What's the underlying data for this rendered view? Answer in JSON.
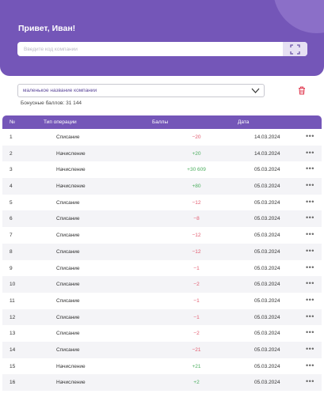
{
  "header": {
    "greeting": "Привет, Иван!",
    "search_placeholder": "Введите код компании",
    "scan_icon": "scan-icon"
  },
  "company": {
    "selected": "маленькое название компании",
    "bonus_text": "Бонусные баллов: 31 144"
  },
  "table": {
    "columns": [
      "№",
      "Тип операции",
      "Баллы",
      "Дата"
    ],
    "rows": [
      {
        "num": "1",
        "type": "Списание",
        "points": "−20",
        "sign": "neg",
        "date": "14.03.2024"
      },
      {
        "num": "2",
        "type": "Начисление",
        "points": "+20",
        "sign": "pos",
        "date": "14.03.2024"
      },
      {
        "num": "3",
        "type": "Начисление",
        "points": "+30 609",
        "sign": "pos",
        "date": "05.03.2024"
      },
      {
        "num": "4",
        "type": "Начисление",
        "points": "+80",
        "sign": "pos",
        "date": "05.03.2024"
      },
      {
        "num": "5",
        "type": "Списание",
        "points": "−12",
        "sign": "neg",
        "date": "05.03.2024"
      },
      {
        "num": "6",
        "type": "Списание",
        "points": "−8",
        "sign": "neg",
        "date": "05.03.2024"
      },
      {
        "num": "7",
        "type": "Списание",
        "points": "−12",
        "sign": "neg",
        "date": "05.03.2024"
      },
      {
        "num": "8",
        "type": "Списание",
        "points": "−12",
        "sign": "neg",
        "date": "05.03.2024"
      },
      {
        "num": "9",
        "type": "Списание",
        "points": "−1",
        "sign": "neg",
        "date": "05.03.2024"
      },
      {
        "num": "10",
        "type": "Списание",
        "points": "−2",
        "sign": "neg",
        "date": "05.03.2024"
      },
      {
        "num": "11",
        "type": "Списание",
        "points": "−1",
        "sign": "neg",
        "date": "05.03.2024"
      },
      {
        "num": "12",
        "type": "Списание",
        "points": "−1",
        "sign": "neg",
        "date": "05.03.2024"
      },
      {
        "num": "13",
        "type": "Списание",
        "points": "−2",
        "sign": "neg",
        "date": "05.03.2024"
      },
      {
        "num": "14",
        "type": "Списание",
        "points": "−21",
        "sign": "neg",
        "date": "05.03.2024"
      },
      {
        "num": "15",
        "type": "Начисление",
        "points": "+21",
        "sign": "pos",
        "date": "05.03.2024"
      },
      {
        "num": "16",
        "type": "Начисление",
        "points": "+2",
        "sign": "pos",
        "date": "05.03.2024"
      }
    ]
  },
  "colors": {
    "primary": "#7456b8",
    "negative": "#e25a6e",
    "positive": "#4cae5f",
    "delete": "#e0394f"
  }
}
